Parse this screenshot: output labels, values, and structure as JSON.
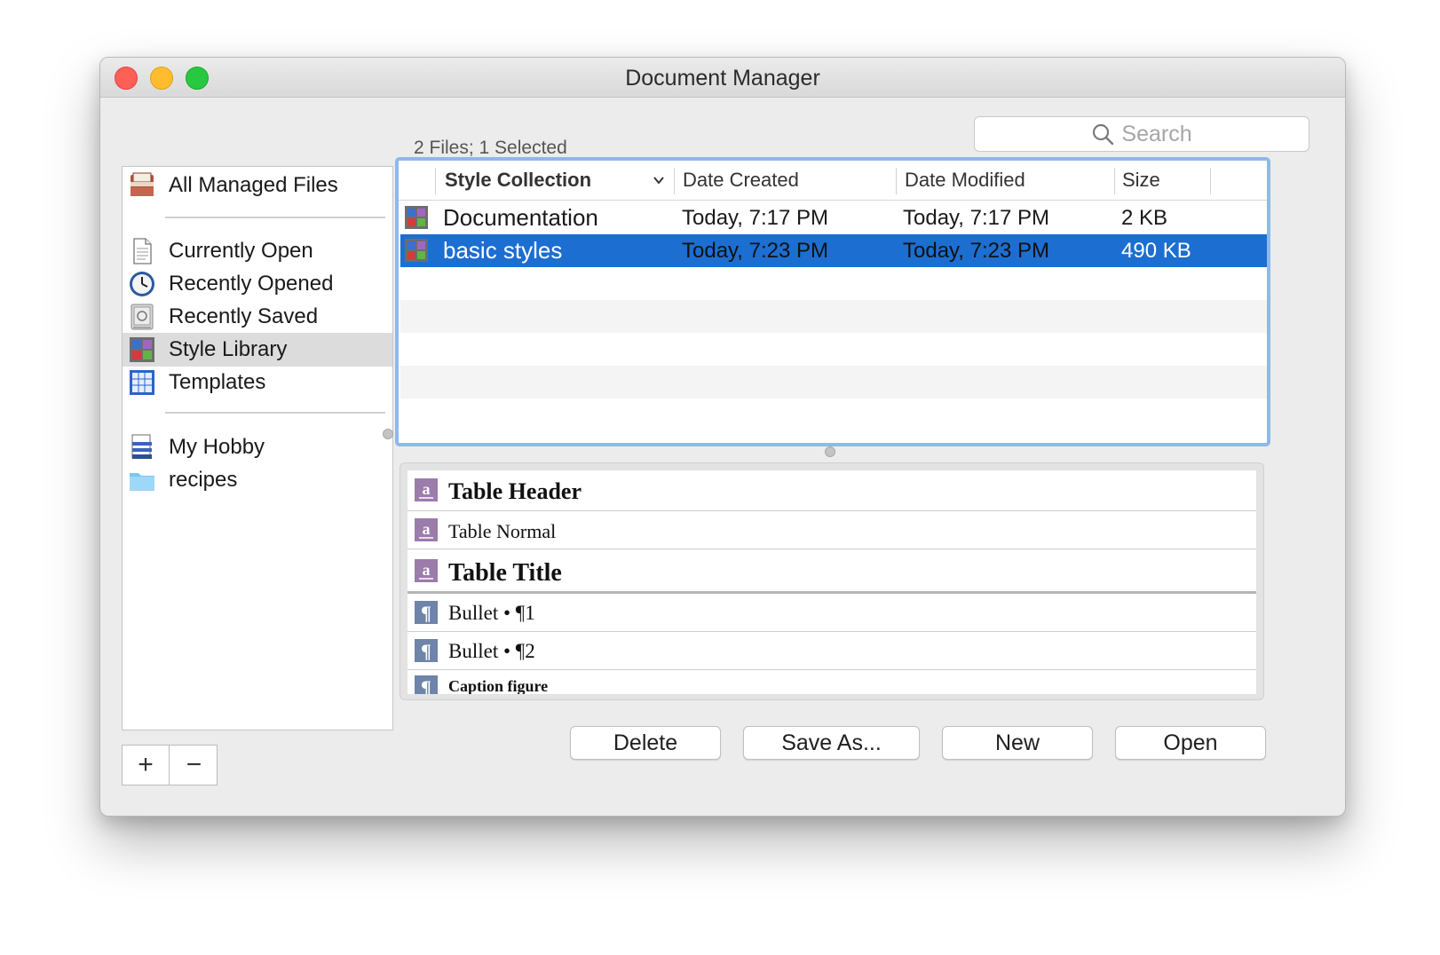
{
  "window": {
    "title": "Document Manager"
  },
  "search": {
    "placeholder": "Search"
  },
  "files_summary": "2 Files; 1 Selected",
  "sidebar": {
    "groups": [
      [
        {
          "label": "All Managed Files",
          "icon": "stacked-documents-icon"
        }
      ],
      [
        {
          "label": "Currently Open",
          "icon": "document-icon"
        },
        {
          "label": "Recently Opened",
          "icon": "clock-icon"
        },
        {
          "label": "Recently Saved",
          "icon": "safe-icon"
        },
        {
          "label": "Style Library",
          "icon": "style-collection-icon",
          "selected": true
        },
        {
          "label": "Templates",
          "icon": "template-grid-icon"
        }
      ],
      [
        {
          "label": "My Hobby",
          "icon": "document-stack-icon"
        },
        {
          "label": "recipes",
          "icon": "folder-icon"
        }
      ]
    ]
  },
  "table": {
    "columns": [
      "Style Collection",
      "Date Created",
      "Date Modified",
      "Size"
    ],
    "rows": [
      {
        "name": "Documentation",
        "created": "Today, 7:17 PM",
        "modified": "Today, 7:17 PM",
        "size": "2 KB",
        "selected": false
      },
      {
        "name": "basic styles",
        "created": "Today, 7:23 PM",
        "modified": "Today, 7:23 PM",
        "size": "490 KB",
        "selected": true
      }
    ]
  },
  "styles": [
    {
      "label": "Table Header",
      "kind": "character-style-icon",
      "weight": "bold"
    },
    {
      "label": "Table Normal",
      "kind": "character-style-icon",
      "weight": "normal"
    },
    {
      "label": "Table Title",
      "kind": "character-style-icon",
      "weight": "bold"
    },
    {
      "label": "Bullet • ¶1",
      "kind": "paragraph-style-icon",
      "weight": "normal"
    },
    {
      "label": "Bullet • ¶2",
      "kind": "paragraph-style-icon",
      "weight": "normal"
    },
    {
      "label": "Caption figure",
      "kind": "paragraph-style-icon",
      "weight": "bold"
    }
  ],
  "buttons": {
    "add": "+",
    "remove": "−",
    "delete": "Delete",
    "save_as": "Save As...",
    "new": "New",
    "open": "Open"
  },
  "colors": {
    "selection": "#1c6ed1",
    "focus_ring": "#8fb8ec",
    "style_icon_char": "#9c7cab",
    "style_icon_para": "#6e84a8"
  }
}
